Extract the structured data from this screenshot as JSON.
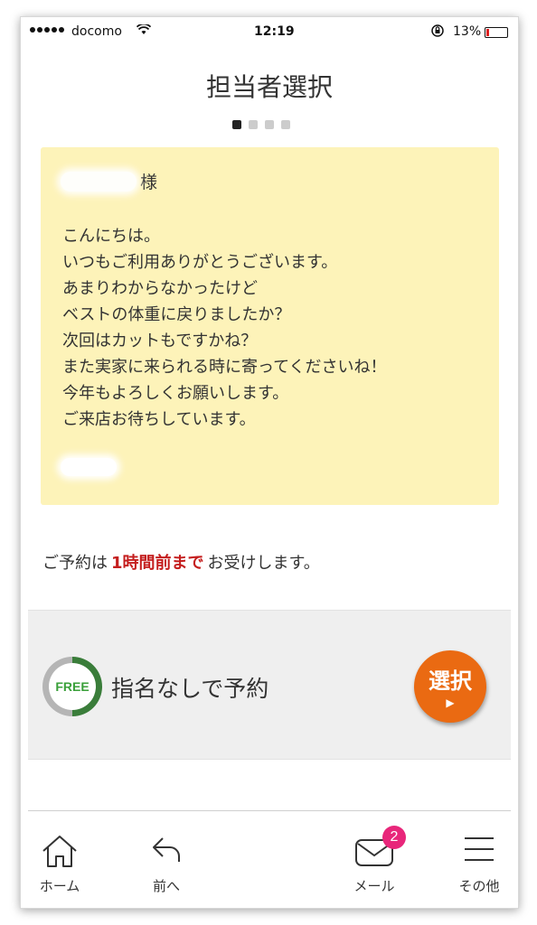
{
  "status_bar": {
    "carrier": "docomo",
    "time": "12:19",
    "battery_percent": "13%"
  },
  "header": {
    "title": "担当者選択",
    "pager_total": 4,
    "pager_active": 1
  },
  "message_card": {
    "name_suffix": "様",
    "lines": [
      "こんにちは。",
      "いつもご利用ありがとうございます。",
      "あまりわからなかったけど",
      "ベストの体重に戻りましたか？",
      "次回はカットもですかね？",
      "また実家に来られる時に寄ってくださいね！",
      "今年もよろしくお願いします。",
      "ご来店お待ちしています。"
    ],
    "background_color": "#fdf3b9"
  },
  "reservation_note": {
    "prefix": "ご予約は",
    "emphasis": "1時間前まで",
    "suffix": "お受けします。",
    "emphasis_color": "#c41e1e"
  },
  "staff_option": {
    "badge_text": "FREE",
    "label": "指名なしで予約",
    "select_button": "選択",
    "select_arrow": "▶",
    "button_color": "#ea6a12"
  },
  "bottom_nav": {
    "home": "ホーム",
    "back": "前へ",
    "mail": "メール",
    "mail_badge": "2",
    "other": "その他"
  }
}
